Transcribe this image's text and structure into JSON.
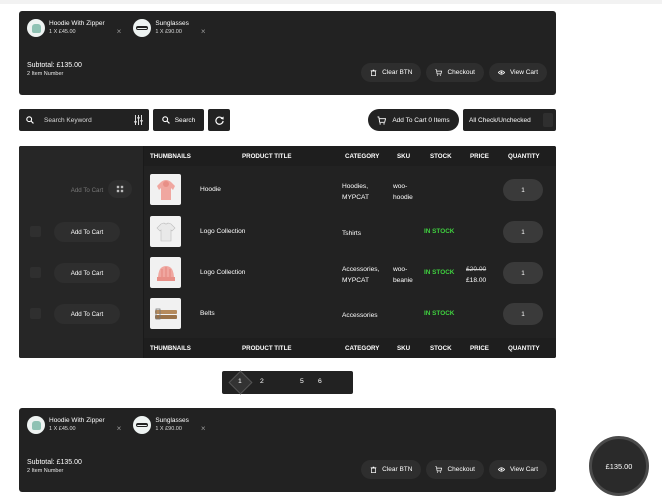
{
  "mini_cart_top": {
    "items": [
      {
        "name": "Hoodie With Zipper",
        "qty": "1 X £45.00",
        "remove": "×"
      },
      {
        "name": "Sunglasses",
        "qty": "1 X £90.00",
        "remove": "×"
      }
    ],
    "subtotal": "Subtotal: £135.00",
    "item_number": "2 Item Number",
    "clear_label": "Clear BTN",
    "checkout_label": "Checkout",
    "view_cart_label": "View Cart"
  },
  "mini_cart_bottom": {
    "items": [
      {
        "name": "Hoodie With Zipper",
        "qty": "1 X £45.00",
        "remove": "×"
      },
      {
        "name": "Sunglasses",
        "qty": "1 X £90.00",
        "remove": "×"
      }
    ],
    "subtotal": "Subtotal: £135.00",
    "item_number": "2 Item Number",
    "clear_label": "Clear BTN",
    "checkout_label": "Checkout",
    "view_cart_label": "View Cart"
  },
  "toolbar": {
    "search_placeholder": "Search Keyword",
    "search_label": "Search",
    "add_to_cart_label": "Add To Cart 0 Items",
    "check_all_label": "All Check/Unchecked"
  },
  "table": {
    "columns": [
      "THUMBNAILS",
      "PRODUCT TITLE",
      "CATEGORY",
      "SKU",
      "STOCK",
      "PRICE",
      "QUANTITY"
    ],
    "rows": [
      {
        "add_label": "Add To Cart",
        "title": "Hoodie",
        "category_1": "Hoodies,",
        "category_2": "MYPCAT",
        "sku_1": "woo-",
        "sku_2": "hoodie",
        "stock": "",
        "price_old": "",
        "price": "",
        "qty": "1",
        "thumb": "hoodie"
      },
      {
        "add_label": "Add To Cart",
        "title": "Logo Collection",
        "category_1": "Tshirts",
        "category_2": "",
        "sku_1": "",
        "sku_2": "",
        "stock": "IN STOCK",
        "price_old": "",
        "price": "",
        "qty": "1",
        "thumb": "tshirt"
      },
      {
        "add_label": "Add To Cart",
        "title": "Logo Collection",
        "category_1": "Accessories,",
        "category_2": "MYPCAT",
        "sku_1": "woo-",
        "sku_2": "beanie",
        "stock": "IN STOCK",
        "price_old": "£20.00",
        "price": "£18.00",
        "qty": "1",
        "thumb": "beanie"
      },
      {
        "add_label": "Add To Cart",
        "title": "Belts",
        "category_1": "Accessories",
        "category_2": "",
        "sku_1": "",
        "sku_2": "",
        "stock": "IN STOCK",
        "price_old": "",
        "price": "",
        "qty": "1",
        "thumb": "belt"
      }
    ]
  },
  "pagination": {
    "current": "1",
    "pages": [
      "2",
      "5",
      "6"
    ]
  },
  "floating_total": "£135.00",
  "colors": {
    "panel": "#222222",
    "in_stock": "#3fd13f",
    "background": "#ffffff"
  }
}
